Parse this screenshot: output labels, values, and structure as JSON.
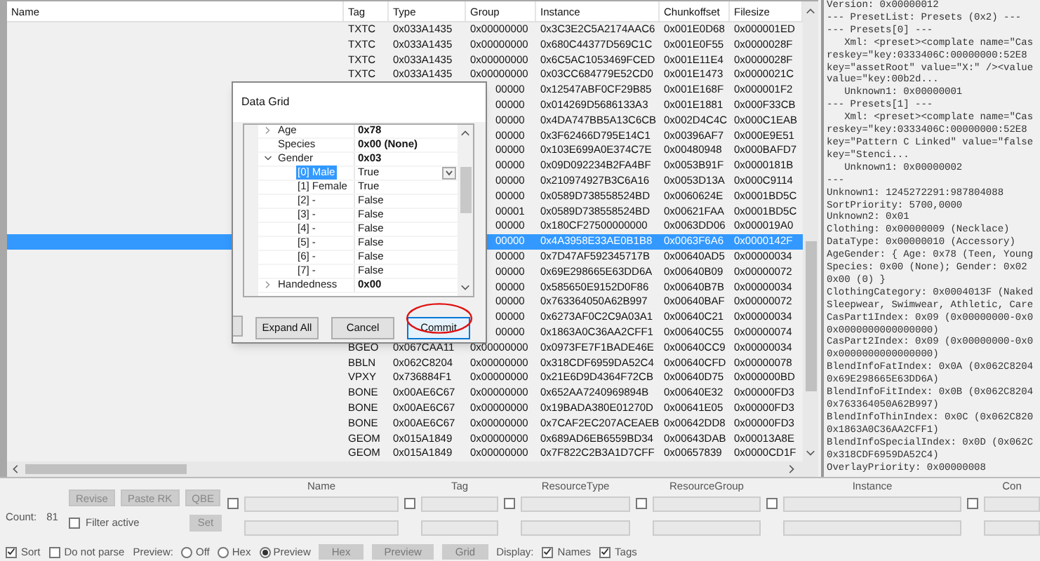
{
  "table": {
    "columns": [
      "Name",
      "Tag",
      "Type",
      "Group",
      "Instance",
      "Chunkoffset",
      "Filesize"
    ],
    "rows": [
      {
        "tag": "TXTC",
        "type": "0x033A1435",
        "group": "0x00000000",
        "instance": "0x3C3E2C5A2174AAC6",
        "chunkoffset": "0x001E0D68",
        "filesize": "0x000001ED",
        "selected": false
      },
      {
        "tag": "TXTC",
        "type": "0x033A1435",
        "group": "0x00000000",
        "instance": "0x680C44377D569C1C",
        "chunkoffset": "0x001E0F55",
        "filesize": "0x0000028F",
        "selected": false
      },
      {
        "tag": "TXTC",
        "type": "0x033A1435",
        "group": "0x00000000",
        "instance": "0x6C5AC1053469FCED",
        "chunkoffset": "0x001E11E4",
        "filesize": "0x0000028F",
        "selected": false
      },
      {
        "tag": "TXTC",
        "type": "0x033A1435",
        "group": "0x00000000",
        "instance": "0x03CC684779E52CD0",
        "chunkoffset": "0x001E1473",
        "filesize": "0x0000021C",
        "selected": false
      },
      {
        "group": "00000",
        "instance": "0x12547ABF0CF29B85",
        "chunkoffset": "0x001E168F",
        "filesize": "0x000001F2",
        "selected": false
      },
      {
        "group": "00000",
        "instance": "0x014269D5686133A3",
        "chunkoffset": "0x001E1881",
        "filesize": "0x000F33CB",
        "selected": false
      },
      {
        "group": "00000",
        "instance": "0x4DA747BB5A13C6CB",
        "chunkoffset": "0x002D4C4C",
        "filesize": "0x000C1EAB",
        "selected": false
      },
      {
        "group": "00000",
        "instance": "0x3F62466D795E14C1",
        "chunkoffset": "0x00396AF7",
        "filesize": "0x000E9E51",
        "selected": false
      },
      {
        "group": "00000",
        "instance": "0x103E699A0E374C7E",
        "chunkoffset": "0x00480948",
        "filesize": "0x000BAFD7",
        "selected": false
      },
      {
        "group": "00000",
        "instance": "0x09D092234B2FA4BF",
        "chunkoffset": "0x0053B91F",
        "filesize": "0x0000181B",
        "selected": false
      },
      {
        "group": "00000",
        "instance": "0x210974927B3C6A16",
        "chunkoffset": "0x0053D13A",
        "filesize": "0x000C9114",
        "selected": false
      },
      {
        "group": "00000",
        "instance": "0x0589D738558524BD",
        "chunkoffset": "0x0060624E",
        "filesize": "0x0001BD5C",
        "selected": false
      },
      {
        "group": "00001",
        "instance": "0x0589D738558524BD",
        "chunkoffset": "0x00621FAA",
        "filesize": "0x0001BD5C",
        "selected": false
      },
      {
        "group": "00000",
        "instance": "0x180CF27500000000",
        "chunkoffset": "0x0063DD06",
        "filesize": "0x000019A0",
        "selected": false
      },
      {
        "group": "00000",
        "instance": "0x4A3958E33AE0B1B8",
        "chunkoffset": "0x0063F6A6",
        "filesize": "0x0000142F",
        "selected": true
      },
      {
        "group": "00000",
        "instance": "0x7D47AF592345717B",
        "chunkoffset": "0x00640AD5",
        "filesize": "0x00000034",
        "selected": false
      },
      {
        "group": "00000",
        "instance": "0x69E298665E63DD6A",
        "chunkoffset": "0x00640B09",
        "filesize": "0x00000072",
        "selected": false
      },
      {
        "group": "00000",
        "instance": "0x585650E9152D0F86",
        "chunkoffset": "0x00640B7B",
        "filesize": "0x00000034",
        "selected": false
      },
      {
        "group": "00000",
        "instance": "0x763364050A62B997",
        "chunkoffset": "0x00640BAF",
        "filesize": "0x00000072",
        "selected": false
      },
      {
        "group": "00000",
        "instance": "0x6273AF0C2C9A03A1",
        "chunkoffset": "0x00640C21",
        "filesize": "0x00000034",
        "selected": false
      },
      {
        "group": "00000",
        "instance": "0x1863A0C36AA2CFF1",
        "chunkoffset": "0x00640C55",
        "filesize": "0x00000074",
        "selected": false
      },
      {
        "tag": "BGEO",
        "type": "0x067CAA11",
        "group": "0x00000000",
        "instance": "0x0973FE7F1BADE46E",
        "chunkoffset": "0x00640CC9",
        "filesize": "0x00000034",
        "selected": false
      },
      {
        "tag": "BBLN",
        "type": "0x062C8204",
        "group": "0x00000000",
        "instance": "0x318CDF6959DA52C4",
        "chunkoffset": "0x00640CFD",
        "filesize": "0x00000078",
        "selected": false
      },
      {
        "tag": "VPXY",
        "type": "0x736884F1",
        "group": "0x00000000",
        "instance": "0x21E6D9D4364F72CB",
        "chunkoffset": "0x00640D75",
        "filesize": "0x000000BD",
        "selected": false
      },
      {
        "tag": "BONE",
        "type": "0x00AE6C67",
        "group": "0x00000000",
        "instance": "0x652AA7240969894B",
        "chunkoffset": "0x00640E32",
        "filesize": "0x00000FD3",
        "selected": false
      },
      {
        "tag": "BONE",
        "type": "0x00AE6C67",
        "group": "0x00000000",
        "instance": "0x19BADA380E01270D",
        "chunkoffset": "0x00641E05",
        "filesize": "0x00000FD3",
        "selected": false
      },
      {
        "tag": "BONE",
        "type": "0x00AE6C67",
        "group": "0x00000000",
        "instance": "0x7CAF2EC207ACEAEB",
        "chunkoffset": "0x00642DD8",
        "filesize": "0x00000FD3",
        "selected": false
      },
      {
        "tag": "GEOM",
        "type": "0x015A1849",
        "group": "0x00000000",
        "instance": "0x689AD6EB6559BD34",
        "chunkoffset": "0x00643DAB",
        "filesize": "0x00013A8E",
        "selected": false
      },
      {
        "tag": "GEOM",
        "type": "0x015A1849",
        "group": "0x00000000",
        "instance": "0x7F822C2B3A1D7CFF",
        "chunkoffset": "0x00657839",
        "filesize": "0x0000CD1F",
        "selected": false
      }
    ]
  },
  "dialog": {
    "title": "Data Grid",
    "rows": [
      {
        "label": "Age",
        "value": "0x78",
        "expanded": false,
        "selected": false
      },
      {
        "label": "Species",
        "value": "0x00 (None)",
        "selected": false
      },
      {
        "label": "Gender",
        "value": "0x03",
        "expanded": true,
        "selected": false,
        "children": [
          {
            "label": "[0] Male",
            "value": "True",
            "selected": true
          },
          {
            "label": "[1] Female",
            "value": "True",
            "selected": false
          },
          {
            "label": "[2] -",
            "value": "False",
            "selected": false
          },
          {
            "label": "[3] -",
            "value": "False",
            "selected": false
          },
          {
            "label": "[4] -",
            "value": "False",
            "selected": false
          },
          {
            "label": "[5] -",
            "value": "False",
            "selected": false
          },
          {
            "label": "[6] -",
            "value": "False",
            "selected": false
          },
          {
            "label": "[7] -",
            "value": "False",
            "selected": false
          }
        ]
      },
      {
        "label": "Handedness",
        "value": "0x00",
        "expanded": false,
        "selected": false
      }
    ],
    "buttons": [
      {
        "label": "Expand All",
        "focused": false
      },
      {
        "label": "Cancel",
        "focused": false
      },
      {
        "label": "Commit",
        "focused": true
      }
    ]
  },
  "details": [
    "Version: 0x00000012",
    "--- PresetList: Presets (0x2) ---",
    "--- Presets[0] ---",
    "   Xml: <preset><complate name=\"Cas",
    "reskey=\"key:0333406C:00000000:52E8",
    "key=\"assetRoot\" value=\"X:\" /><value",
    "value=\"key:00b2d...",
    "   Unknown1: 0x00000001",
    "--- Presets[1] ---",
    "   Xml: <preset><complate name=\"Cas",
    "reskey=\"key:0333406C:00000000:52E8",
    "key=\"Pattern C Linked\" value=\"false",
    "key=\"Stenci...",
    "   Unknown1: 0x00000002",
    "---",
    "Unknown1: 1245272291:987804088",
    "SortPriority: 5700,0000",
    "Unknown2: 0x01",
    "Clothing: 0x00000009 (Necklace)",
    "DataType: 0x00000010 (Accessory)",
    "AgeGender: { Age: 0x78 (Teen, Young",
    "Species: 0x00 (None); Gender: 0x02",
    "0x00 (0) }",
    "ClothingCategory: 0x0004013F (Naked",
    "Sleepwear, Swimwear, Athletic, Care",
    "CasPart1Index: 0x09 (0x00000000-0x0",
    "0x0000000000000000)",
    "CasPart2Index: 0x09 (0x00000000-0x0",
    "0x0000000000000000)",
    "BlendInfoFatIndex: 0x0A (0x062C8204",
    "0x69E298665E63DD6A)",
    "BlendInfoFitIndex: 0x0B (0x062C8204",
    "0x763364050A62B997)",
    "BlendInfoThinIndex: 0x0C (0x062C820",
    "0x1863A0C36AA2CFF1)",
    "BlendInfoSpecialIndex: 0x0D (0x062C",
    "0x318CDF6959DA52C4)",
    "OverlayPriority: 0x00000008"
  ],
  "bottom": {
    "count_label": "Count:",
    "count": "81",
    "buttons": [
      {
        "label": "Revise",
        "disabled": true
      },
      {
        "label": "Paste RK",
        "disabled": true
      },
      {
        "label": "QBE",
        "disabled": true
      }
    ],
    "filter_active": {
      "label": "Filter active",
      "checked": false
    },
    "set_button": {
      "label": "Set",
      "disabled": true
    },
    "filters": [
      {
        "label": "Name",
        "checked": false
      },
      {
        "label": "Tag",
        "checked": false
      },
      {
        "label": "ResourceType",
        "checked": false
      },
      {
        "label": "ResourceGroup",
        "checked": false
      },
      {
        "label": "Instance",
        "checked": false
      },
      {
        "label": "Con",
        "checked": false
      }
    ],
    "options": [
      {
        "kind": "checkbox",
        "label": "Sort",
        "checked": true
      },
      {
        "kind": "checkbox",
        "label": "Do not parse",
        "checked": false
      },
      {
        "kind": "label",
        "label": "Preview:"
      },
      {
        "kind": "radio",
        "label": "Off",
        "selected": false
      },
      {
        "kind": "radio",
        "label": "Hex",
        "selected": false
      },
      {
        "kind": "radio",
        "label": "Preview",
        "selected": true
      },
      {
        "kind": "button",
        "label": "Hex"
      },
      {
        "kind": "button",
        "label": "Preview"
      },
      {
        "kind": "button",
        "label": "Grid"
      },
      {
        "kind": "label",
        "label": "Display:"
      },
      {
        "kind": "checkbox",
        "label": "Names",
        "checked": true
      },
      {
        "kind": "checkbox",
        "label": "Tags",
        "checked": true
      }
    ]
  }
}
